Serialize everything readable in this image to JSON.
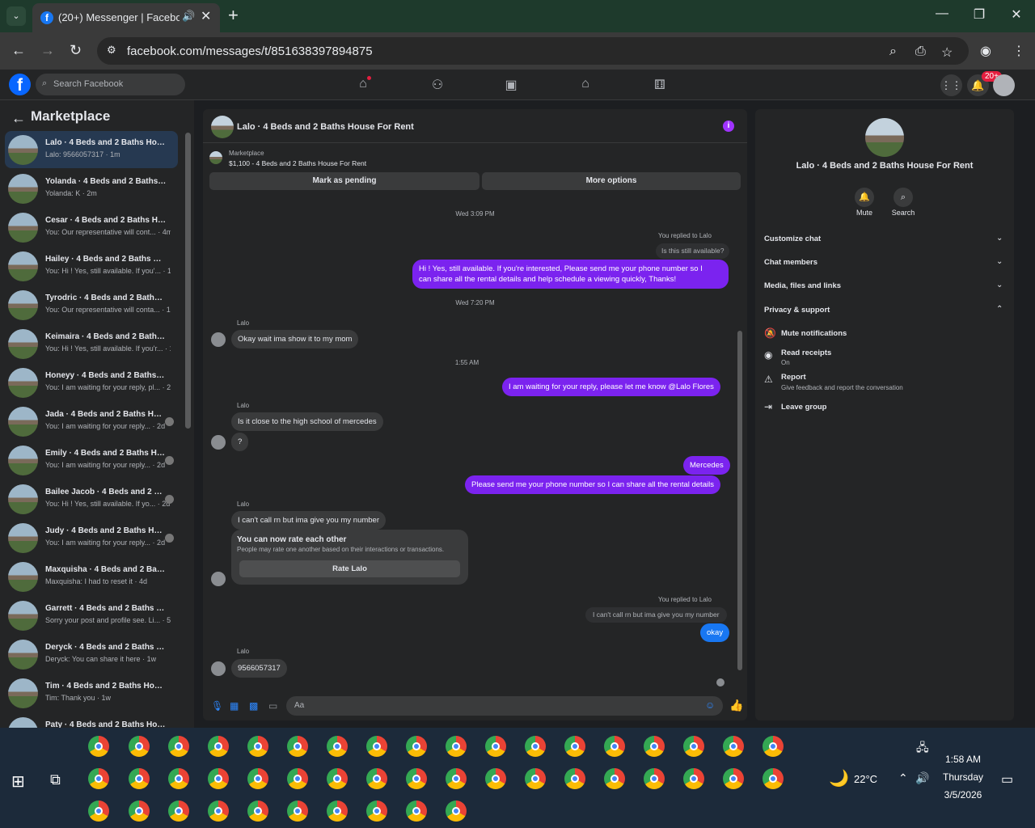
{
  "browser": {
    "tab_title": "(20+) Messenger | Facebook",
    "url": "facebook.com/messages/t/851638397894875",
    "new_tab": "+",
    "minimize": "—",
    "maximize": "❐",
    "close": "✕"
  },
  "fb": {
    "logo": "f",
    "search_placeholder": "Search Facebook",
    "notif_badge": "20+",
    "nav_icons": [
      "home-icon",
      "friends-icon",
      "watch-icon",
      "marketplace-icon",
      "gaming-icon"
    ]
  },
  "left": {
    "title": "Marketplace",
    "conversations": [
      {
        "name": "Lalo · 4 Beds and 2 Baths House For Rent",
        "preview": "Lalo: 9566057317 · 1m",
        "active": true
      },
      {
        "name": "Yolanda · 4 Beds and 2 Baths House For Rent",
        "preview": "Yolanda: K · 2m"
      },
      {
        "name": "Cesar · 4 Beds and 2 Baths House For Rent",
        "preview": "You: Our representative will cont... · 4m"
      },
      {
        "name": "Hailey · 4 Beds and 2 Baths House For Rent",
        "preview": "You: Hi ! Yes, still available. If you'... · 10h"
      },
      {
        "name": "Tyrodric · 4 Beds and 2 Baths House For Rent",
        "preview": "You: Our representative will conta... · 1d"
      },
      {
        "name": "Keimaira · 4 Beds and 2 Baths House For Rent",
        "preview": "You: Hi ! Yes, still available. If you'r... · 1d"
      },
      {
        "name": "Honeyy · 4 Beds and 2 Baths House For Rent",
        "preview": "You: I am waiting for your reply, pl... · 2d"
      },
      {
        "name": "Jada · 4 Beds and 2 Baths House For Rent",
        "preview": "You: I am waiting for your reply... · 2d"
      },
      {
        "name": "Emily · 4 Beds and 2 Baths House For Rent",
        "preview": "You: I am waiting for your reply... · 2d"
      },
      {
        "name": "Bailee Jacob · 4 Beds and 2 Baths House For Rent",
        "preview": "You: Hi ! Yes, still available. If yo... · 2d"
      },
      {
        "name": "Judy · 4 Beds and 2 Baths House For Rent",
        "preview": "You: I am waiting for your reply... · 2d"
      },
      {
        "name": "Maxquisha · 4 Beds and 2 Baths House For Rent",
        "preview": "Maxquisha: I had to reset it · 4d"
      },
      {
        "name": "Garrett · 4 Beds and 2 Baths House For Rent",
        "preview": "Sorry your post and profile see. Li... · 5d"
      },
      {
        "name": "Deryck · 4 Beds and 2 Baths House For Rent",
        "preview": "Deryck: You can share it here · 1w"
      },
      {
        "name": "Tim · 4 Beds and 2 Baths House For Rent",
        "preview": "Tim: Thank you · 1w"
      },
      {
        "name": "Paty · 4 Beds and 2 Baths House For Rent",
        "preview": ""
      }
    ]
  },
  "chat": {
    "title": "Lalo · 4 Beds and 2 Baths House For Rent",
    "marketplace_label": "Marketplace",
    "listing": "$1,100 - 4 Beds and 2 Baths House For Rent",
    "mark_pending": "Mark as pending",
    "more_options": "More options",
    "ts1": "Wed 3:09 PM",
    "replied1": "You replied to Lalo",
    "quote1": "Is this still available?",
    "msg_out1a": "Hi ! Yes, still available. If you're interested, Please send me your phone number so I",
    "msg_out1b": "can share all the rental details and help schedule a viewing quickly, Thanks!",
    "ts2": "Wed 7:20 PM",
    "sender": "Lalo",
    "msg_in1": "Okay wait ima show it to my mom",
    "ts3": "1:55 AM",
    "msg_out2": "I am waiting for your reply, please let me know @Lalo Flores",
    "msg_in2": "Is it close to the high school of mercedes",
    "msg_in3": "?",
    "msg_out3": "Mercedes",
    "msg_out4": "Please send me your phone number so I can share all the rental details",
    "msg_in4": "I can't call rn but ima give you my number",
    "rate_title": "You can now rate each other",
    "rate_desc": "People may rate one another based on their interactions or transactions.",
    "rate_button": "Rate Lalo",
    "replied2": "You replied to Lalo",
    "quote2": "I can't call rn but ima give you my number",
    "msg_out5": "okay",
    "msg_in5": "9566057317",
    "input_placeholder": "Aa"
  },
  "info": {
    "name": "Lalo · 4 Beds and 2 Baths House For Rent",
    "mute": "Mute",
    "search": "Search",
    "sections": [
      "Customize chat",
      "Chat members",
      "Media, files and links",
      "Privacy & support"
    ],
    "mute_notifications": "Mute notifications",
    "read_receipts": "Read receipts",
    "read_receipts_state": "On",
    "report": "Report",
    "report_desc": "Give feedback and report the conversation",
    "leave_group": "Leave group"
  },
  "taskbar": {
    "weather": "22°C",
    "time": "1:58 AM",
    "day": "Thursday",
    "date": "3/5/2026"
  },
  "colors": {
    "accent": "#0866ff",
    "outgoing_bubble": "#7b23ef",
    "panel": "#242526",
    "background": "#1c1e21"
  }
}
